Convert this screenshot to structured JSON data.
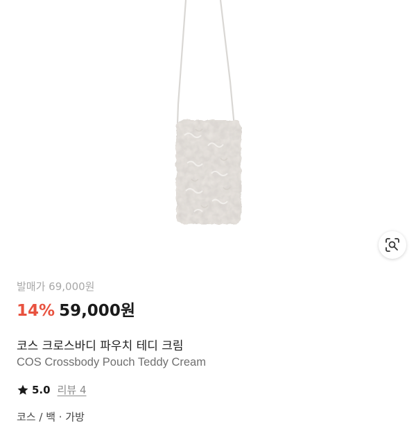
{
  "product": {
    "image_alt": "COS Crossbody Pouch Teddy Cream",
    "release_price": "발매가 69,000원",
    "discount": "14%",
    "price": "59,000원",
    "title_ko": "코스 크로스바디 파우치 테디 크림",
    "title_en": "COS Crossbody Pouch Teddy Cream",
    "rating": "5.0",
    "review_label": "리뷰 4",
    "brand_partial": "코스 / 백 · 가방"
  },
  "icons": {
    "lens": "lens-search-icon",
    "star": "star-icon"
  },
  "colors": {
    "discount": "#e8523f",
    "muted": "#a7a7a7",
    "text": "#1a1a1a"
  }
}
